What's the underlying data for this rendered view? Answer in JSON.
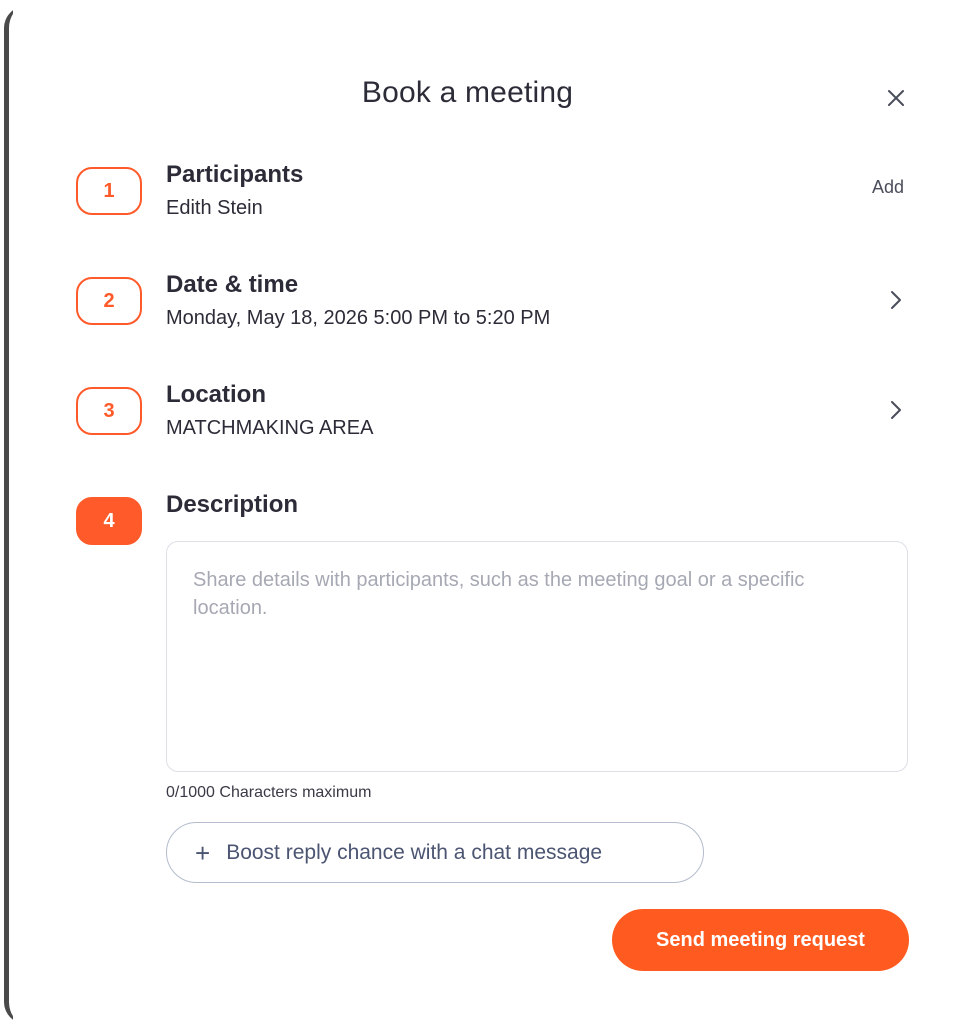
{
  "modal": {
    "title": "Book a meeting"
  },
  "steps": [
    {
      "number": "1",
      "title": "Participants",
      "value": "Edith Stein",
      "action_label": "Add"
    },
    {
      "number": "2",
      "title": "Date & time",
      "value": "Monday, May 18, 2026 5:00 PM to 5:20 PM"
    },
    {
      "number": "3",
      "title": "Location",
      "value": "MATCHMAKING AREA"
    },
    {
      "number": "4",
      "title": "Description"
    }
  ],
  "description": {
    "value": "",
    "placeholder": "Share details with participants, such as the meeting goal or a specific location.",
    "char_count": "0/1000 Characters maximum"
  },
  "boost": {
    "icon": "plus-icon",
    "label": "Boost reply chance with a chat message"
  },
  "send": {
    "label": "Send meeting request"
  },
  "colors": {
    "accent": "#ff5a1f",
    "text": "#2c2c38",
    "muted": "#a6a9b3"
  }
}
